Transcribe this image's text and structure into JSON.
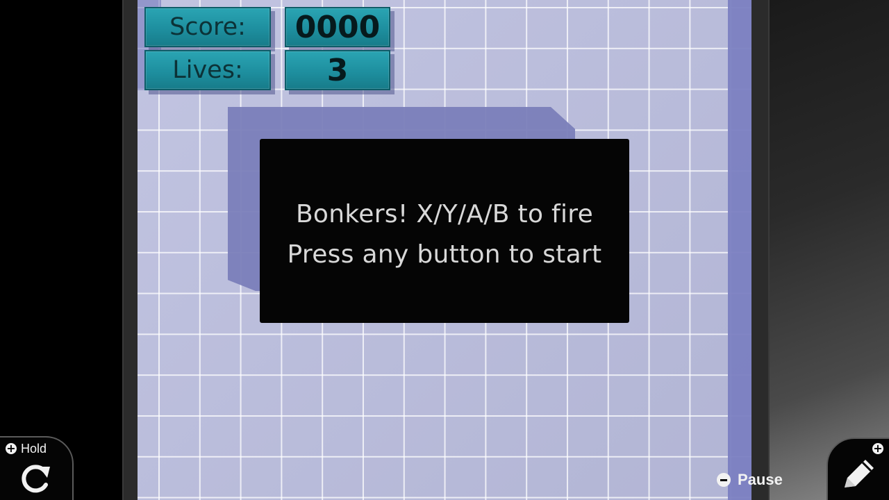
{
  "hud": {
    "score_label": "Score:",
    "score_value": "0000",
    "lives_label": "Lives:",
    "lives_value": "3"
  },
  "message": {
    "line1": "Bonkers! X/Y/A/B to fire",
    "line2": "Press any button to start"
  },
  "controls": {
    "hold_label": "Hold",
    "hold_icon": "rotate-icon",
    "pause_label": "Pause",
    "pencil_icon": "pencil-icon"
  },
  "colors": {
    "playfield": "#b9bcdd",
    "hud_teal": "#2aa4b3",
    "wall": "#7b7fc1",
    "panel": "#050505"
  }
}
